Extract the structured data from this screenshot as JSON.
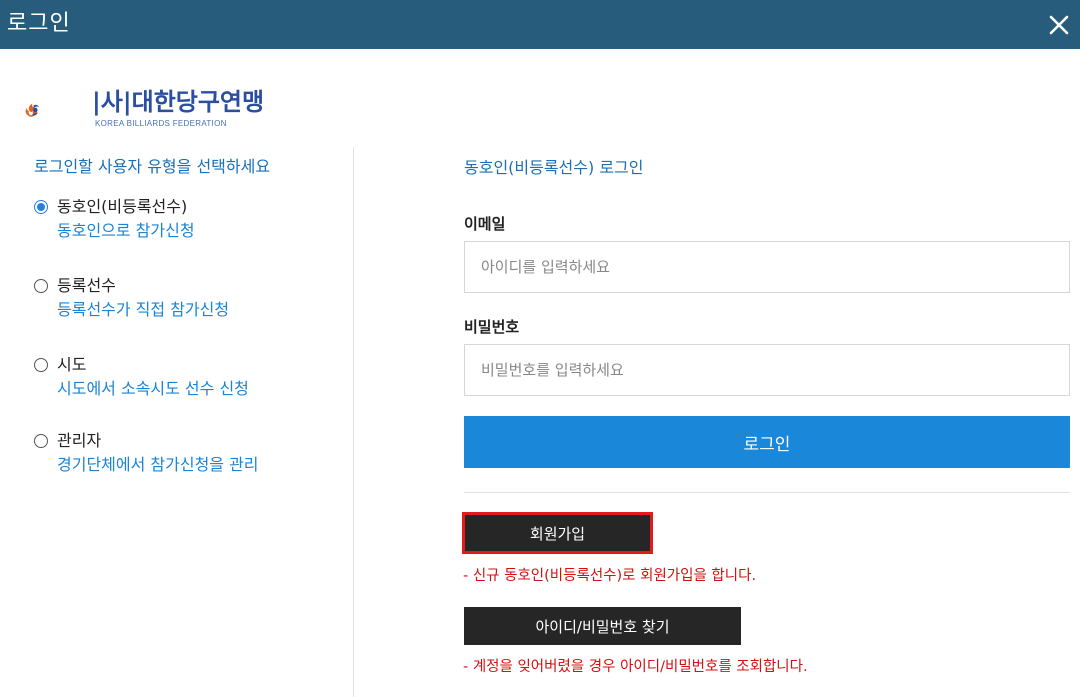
{
  "window": {
    "title": "로그인",
    "close_icon": "close-icon"
  },
  "brand": {
    "name": "|사|대한당구연맹",
    "subtitle": "KOREA BILLIARDS FEDERATION",
    "colors": {
      "flame_orange": "#e8601c",
      "flame_blue": "#2a4f9e"
    }
  },
  "left_panel": {
    "heading": "로그인할 사용자 유형을 선택하세요",
    "roles": [
      {
        "label": "동호인(비등록선수)",
        "description": "동호인으로 참가신청",
        "selected": true
      },
      {
        "label": "등록선수",
        "description": "등록선수가 직접 참가신청",
        "selected": false
      },
      {
        "label": "시도",
        "description": "시도에서 소속시도 선수 신청",
        "selected": false
      },
      {
        "label": "관리자",
        "description": "경기단체에서 참가신청을 관리",
        "selected": false
      }
    ]
  },
  "right_panel": {
    "heading": "동호인(비등록선수) 로그인",
    "email": {
      "label": "이메일",
      "placeholder": "아이디를 입력하세요",
      "value": ""
    },
    "password": {
      "label": "비밀번호",
      "placeholder": "비밀번호를 입력하세요",
      "value": ""
    },
    "login_label": "로그인",
    "signup_label": "회원가입",
    "signup_note": "- 신규 동호인(비등록선수)로 회원가입을 합니다.",
    "find_label": "아이디/비밀번호 찾기",
    "find_note": "- 계정을 잊어버렸을 경우 아이디/비밀번호를 조회합니다."
  },
  "colors": {
    "titlebar": "#285c7c",
    "accent": "#1a87d8",
    "note_red": "#d41010",
    "highlight_border": "#e31b1b"
  }
}
